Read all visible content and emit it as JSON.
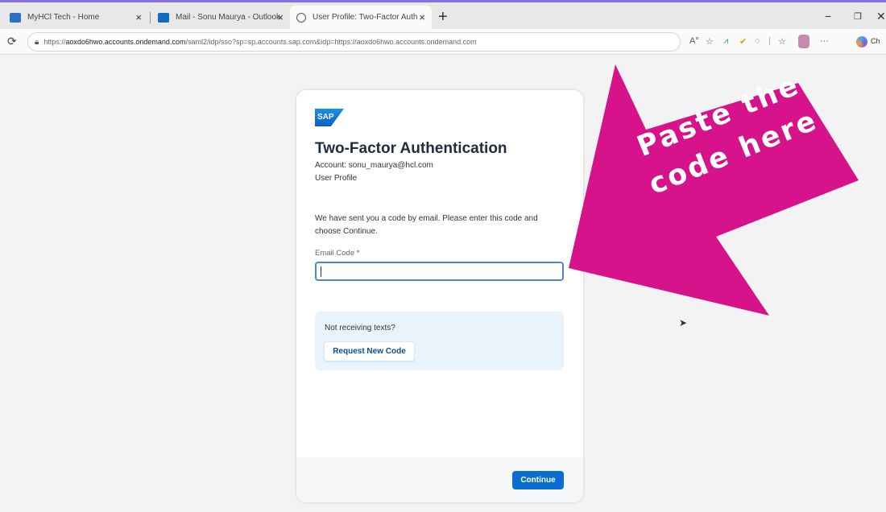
{
  "colors": {
    "accent": "#0a6ed1",
    "annotation": "#d6138a",
    "help_bg": "#e9f3fc"
  },
  "browser": {
    "tabs": [
      {
        "title": "MyHCl Tech - Home",
        "icon": "sharepoint-icon",
        "close": "×"
      },
      {
        "title": "Mail - Sonu Maurya - Outlook",
        "icon": "outlook-icon",
        "close": "×"
      },
      {
        "title": "User Profile: Two-Factor Authentic",
        "icon": "globe-icon",
        "close": "×",
        "active": true
      }
    ],
    "new_tab": "+",
    "url": {
      "scheme": "https://",
      "host": "aoxdo6hwo.accounts.ondemand.com",
      "path": "/saml2/idp/sso?sp=sp.accounts.sap.com&idp=https://aoxdo6hwo.accounts.ondemand.com"
    },
    "copilot_label": "Ch",
    "window_controls": {
      "minimize": "−",
      "restore": "❐",
      "close": "✕"
    }
  },
  "card": {
    "logo_text": "SAP",
    "title": "Two-Factor Authentication",
    "account": "Account: sonu_maurya@hcl.com",
    "subtitle": "User Profile",
    "instructions": "We have sent you a code by email. Please enter this code and choose Continue.",
    "email_code_label": "Email Code",
    "required_mark": "*",
    "email_code_value": "",
    "help_question": "Not receiving texts?",
    "request_button": "Request New Code",
    "continue_button": "Continue"
  },
  "annotation": {
    "text_line1": "Paste the",
    "text_line2": "code here"
  }
}
